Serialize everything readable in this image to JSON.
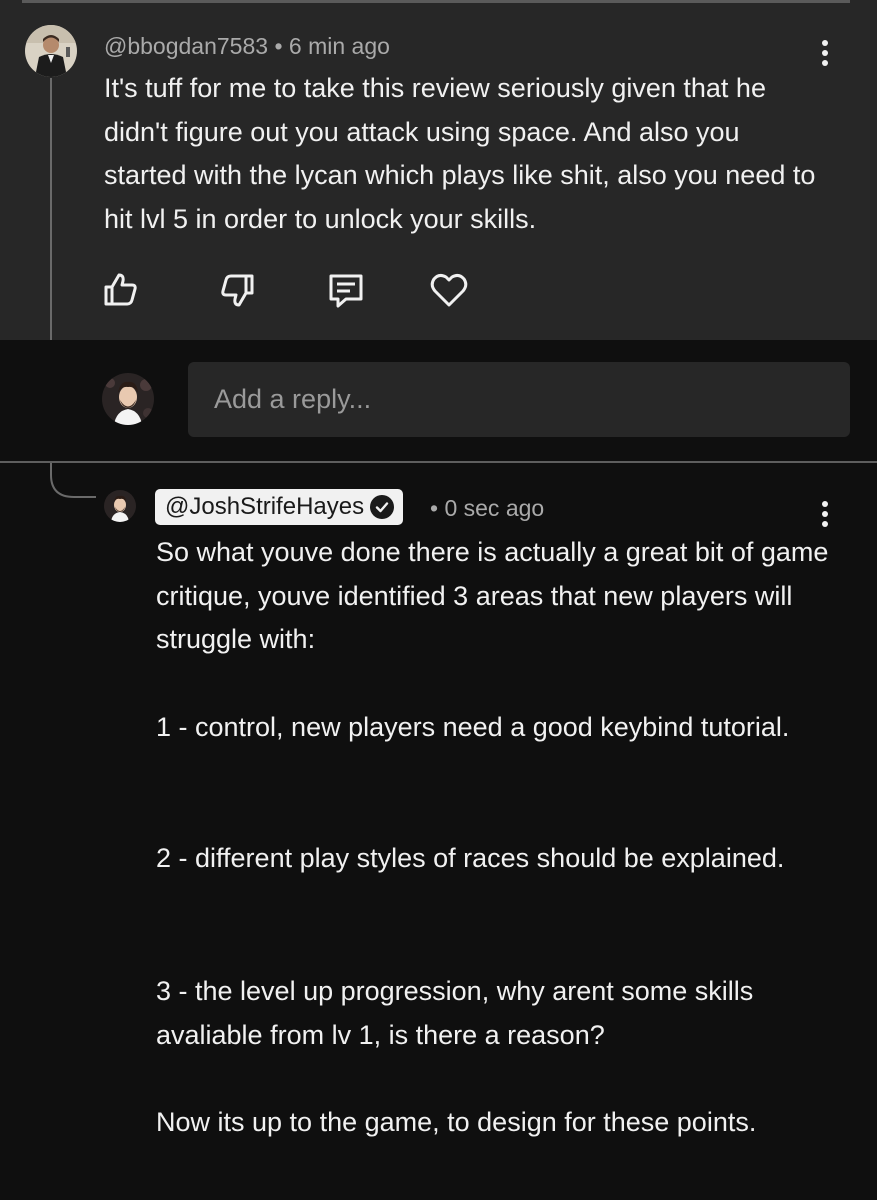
{
  "comment": {
    "author": "@bbogdan7583",
    "separator": "•",
    "time": "6 min ago",
    "text": "It's tuff for me to take this review seriously given that he didn't figure out you attack using space. And also you started with the lycan which plays like shit, also you need to hit lvl 5 in order to unlock your skills.",
    "actions": [
      "thumbs-up-icon",
      "thumbs-down-icon",
      "reply-icon",
      "heart-icon"
    ]
  },
  "reply_input": {
    "placeholder": "Add a reply..."
  },
  "reply": {
    "author": "@JoshStrifeHayes",
    "verified": true,
    "separator": "•",
    "time": "0 sec ago",
    "paragraphs": [
      "So what youve done there is actually a great bit of game critique, youve identified 3 areas that new players will struggle with:",
      "1 - control, new players need a good keybind tutorial.",
      "2 - different play styles of races should be explained.",
      "3 - the level up progression, why arent some skills avaliable from lv 1, is there a reason?",
      "Now its up to the game, to design for these points."
    ]
  },
  "colors": {
    "background": "#0f0f0f",
    "comment_card": "#272727",
    "text_primary": "#f1f1f1",
    "text_secondary": "#aaaaaa",
    "handle_chip": "#f1f1f1"
  }
}
